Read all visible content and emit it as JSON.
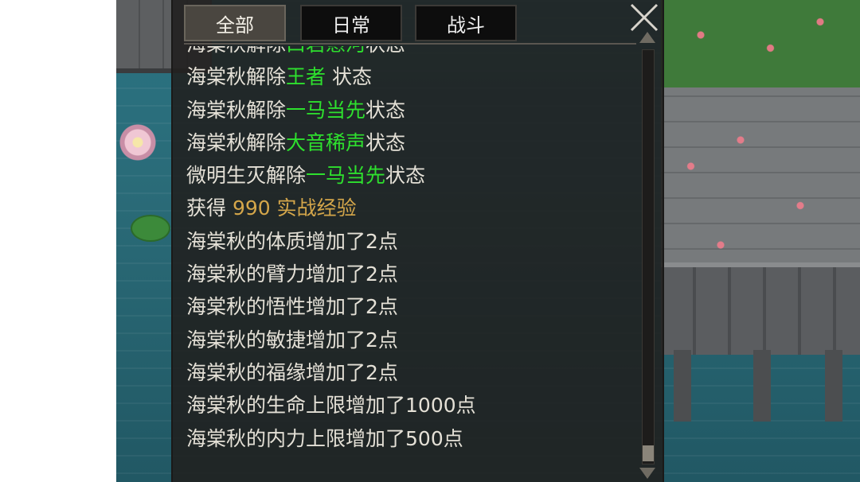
{
  "tabs": [
    {
      "label": "全部",
      "active": true
    },
    {
      "label": "日常",
      "active": false
    },
    {
      "label": "战斗",
      "active": false
    }
  ],
  "colors": {
    "highlight_green": "#2ee02e",
    "highlight_gold": "#d4a64a",
    "text": "#e4e0d6"
  },
  "icons": {
    "close": "close-x-icon",
    "scroll_up": "scroll-up-icon",
    "scroll_down": "scroll-down-icon"
  },
  "log_lines": [
    {
      "prefix": "海棠秋解除",
      "highlight": "口若悬河",
      "suffix": "状态",
      "hl": "green"
    },
    {
      "prefix": "海棠秋解除",
      "highlight": "王者 ",
      "suffix": "状态",
      "hl": "green"
    },
    {
      "prefix": "海棠秋解除",
      "highlight": "一马当先",
      "suffix": "状态",
      "hl": "green"
    },
    {
      "prefix": "海棠秋解除",
      "highlight": "大音稀声",
      "suffix": "状态",
      "hl": "green"
    },
    {
      "prefix": "微明生灭解除",
      "highlight": "一马当先",
      "suffix": "状态",
      "hl": "green"
    },
    {
      "prefix": "获得 ",
      "highlight": "990 实战经验",
      "suffix": "",
      "hl": "gold"
    },
    {
      "prefix": "海棠秋的体质增加了2点",
      "highlight": "",
      "suffix": "",
      "hl": ""
    },
    {
      "prefix": "海棠秋的臂力增加了2点",
      "highlight": "",
      "suffix": "",
      "hl": ""
    },
    {
      "prefix": "海棠秋的悟性增加了2点",
      "highlight": "",
      "suffix": "",
      "hl": ""
    },
    {
      "prefix": "海棠秋的敏捷增加了2点",
      "highlight": "",
      "suffix": "",
      "hl": ""
    },
    {
      "prefix": "海棠秋的福缘增加了2点",
      "highlight": "",
      "suffix": "",
      "hl": ""
    },
    {
      "prefix": "海棠秋的生命上限增加了1000点",
      "highlight": "",
      "suffix": "",
      "hl": ""
    },
    {
      "prefix": "海棠秋的内力上限增加了500点",
      "highlight": "",
      "suffix": "",
      "hl": ""
    }
  ]
}
